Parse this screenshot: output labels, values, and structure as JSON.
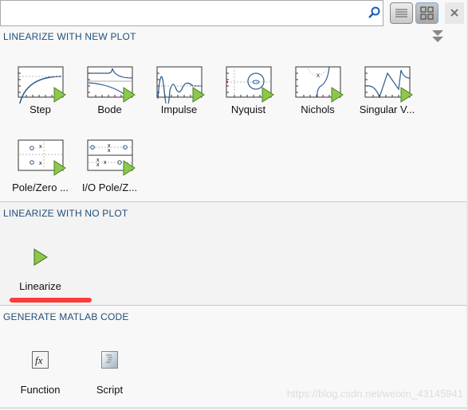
{
  "search": {
    "placeholder": "",
    "value": ""
  },
  "toolbar": {
    "list_view": "list-view",
    "grid_view": "grid-view",
    "close": "close"
  },
  "sections": [
    {
      "title": "LINEARIZE WITH NEW PLOT",
      "items": [
        {
          "label": "Step"
        },
        {
          "label": "Bode"
        },
        {
          "label": "Impulse"
        },
        {
          "label": "Nyquist"
        },
        {
          "label": "Nichols"
        },
        {
          "label": "Singular V..."
        },
        {
          "label": "Pole/Zero ..."
        },
        {
          "label": "I/O Pole/Z..."
        }
      ]
    },
    {
      "title": "LINEARIZE WITH NO PLOT",
      "items": [
        {
          "label": "Linearize"
        }
      ]
    },
    {
      "title": "GENERATE MATLAB CODE",
      "items": [
        {
          "label": "Function"
        },
        {
          "label": "Script"
        }
      ]
    }
  ],
  "watermark": "https://blog.csdn.net/weixin_43145941",
  "colors": {
    "header": "#1f4e79",
    "play": "#7cbf3a",
    "highlight": "#ff3b3b",
    "curve": "#2f5b8c"
  }
}
